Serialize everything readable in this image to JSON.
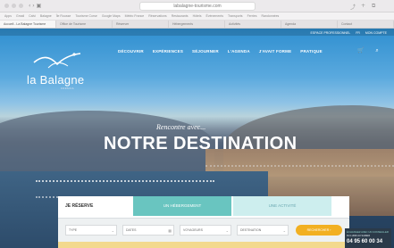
{
  "browser": {
    "url": "labalagne-tourisme.com",
    "nav": "‹ › ▣",
    "tab_buttons": [
      "⤴",
      "+",
      "⧉"
    ],
    "bookmarks": [
      "Apps",
      "Gmail",
      "Calvi",
      "Balagne",
      "Île Rousse",
      "Tourisme Corse",
      "Google Maps",
      "Météo France",
      "Réservations",
      "Restaurants",
      "Hôtels",
      "Événements",
      "Transports",
      "Ferries",
      "Randonnées"
    ],
    "tabs": [
      "Accueil - La Balagne Tourisme",
      "Office de Tourisme",
      "Réserver",
      "Hébergements",
      "Activités",
      "Agenda",
      "Contact"
    ]
  },
  "site": {
    "gov_links": [
      "ESPACE PROFESSIONNEL",
      "FR",
      "MON COMPTE"
    ],
    "logo": {
      "name": "la Balagne",
      "sub": "CORSICA"
    },
    "nav_items": [
      "DÉCOUVRIR",
      "EXPÉRIENCES",
      "SÉJOURNER",
      "L'AGENDA",
      "J'AVAIT FORME",
      "PRATIQUE"
    ],
    "icons": {
      "cart": "🛒",
      "search": "⌕"
    },
    "hero": {
      "subtitle": "Rencontre avec...",
      "title": "NOTRE DESTINATION"
    },
    "booking": {
      "title": "JE RÉSERVE",
      "tabs": [
        "UN HÉBERGEMENT",
        "UNE ACTIVITÉ"
      ],
      "fields": [
        {
          "label": "TYPE",
          "chevron": "⌄"
        },
        {
          "label": "DATES",
          "chevron": "▦"
        },
        {
          "label": "VOYAGEURS",
          "chevron": "⌄"
        },
        {
          "label": "DESTINATION",
          "chevron": "⌄"
        }
      ],
      "button": "RECHERCHER ›"
    },
    "contact": {
      "line1": "ÉCHANGEZ AVEC UN CONSEILLER",
      "line2": "DU LUNDI AU SAMEDI",
      "phone": "04 95 60 00 34"
    }
  }
}
